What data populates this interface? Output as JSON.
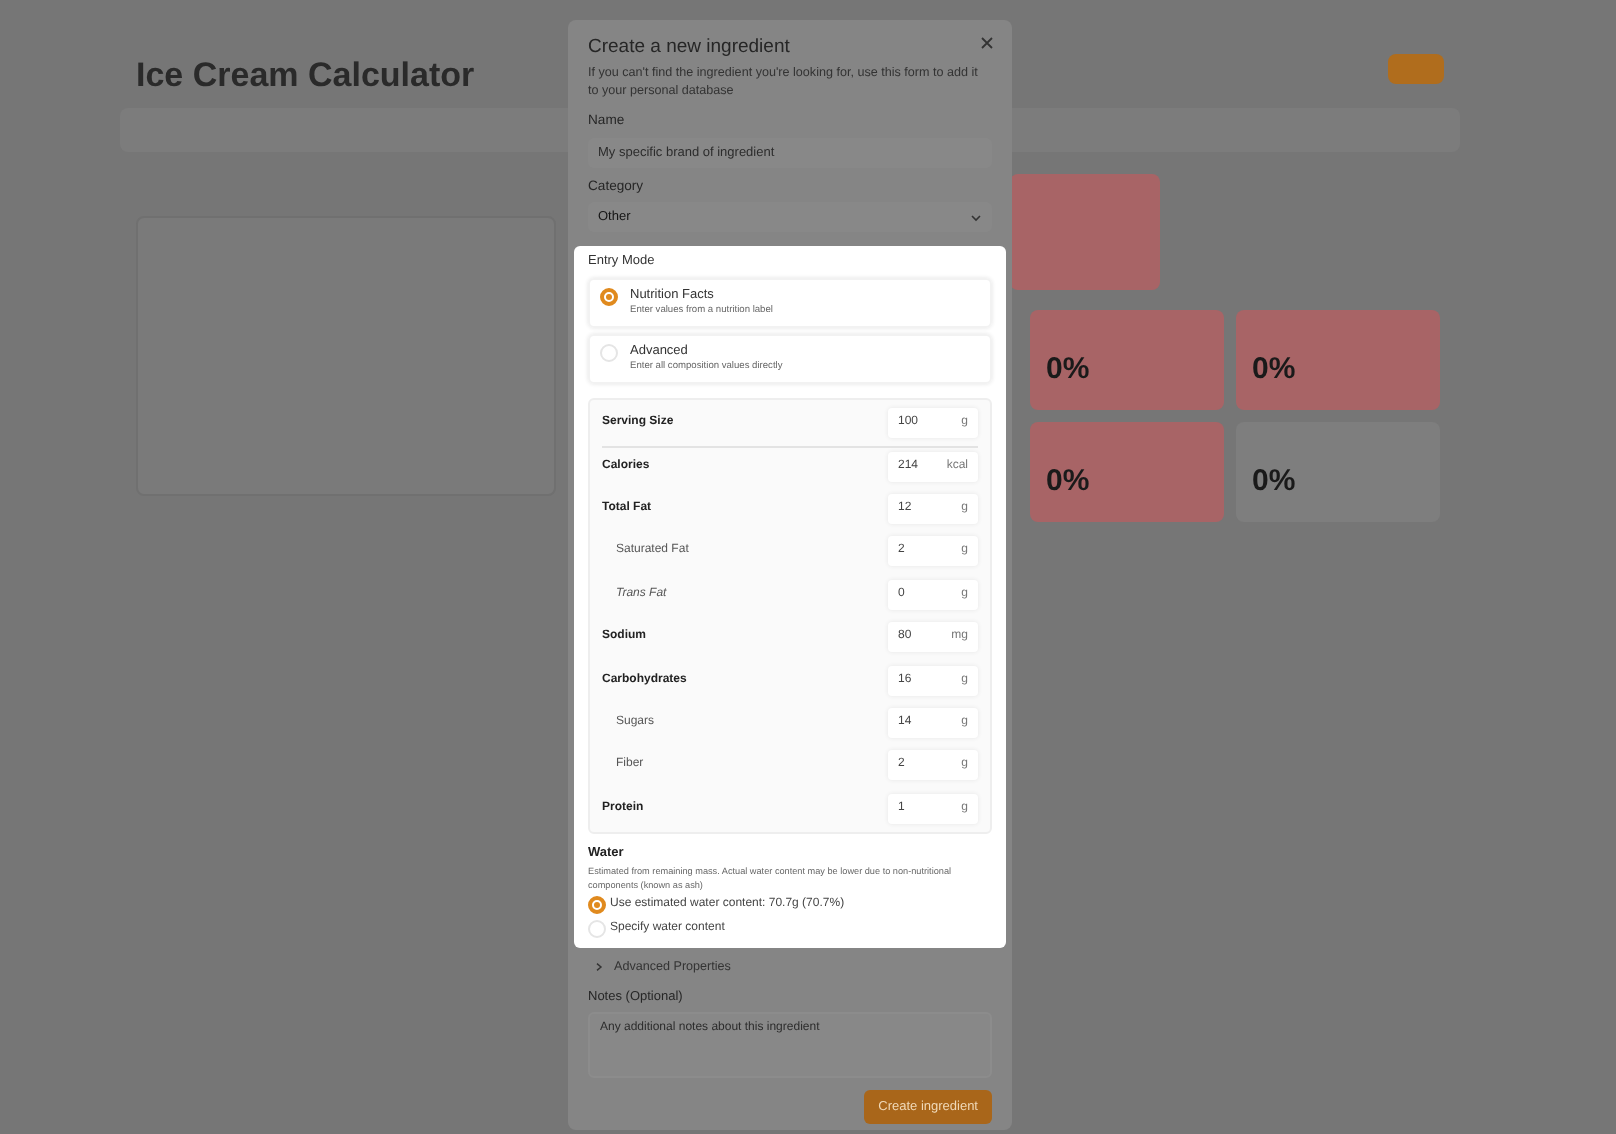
{
  "background": {
    "title": "Ice Cream Calculator",
    "cards": [
      {
        "value": "0%",
        "alert": true
      },
      {
        "value": "0%",
        "alert": true
      },
      {
        "value": "0%",
        "alert": true
      },
      {
        "value": "0%",
        "alert": false
      }
    ]
  },
  "dialog": {
    "title": "Create a new ingredient",
    "description": "If you can't find the ingredient you're looking for, use this form to add it to your personal database",
    "name": {
      "label": "Name",
      "placeholder": "My specific brand of ingredient"
    },
    "category": {
      "label": "Category",
      "value": "Other"
    },
    "entry_mode": {
      "label": "Entry Mode",
      "options": [
        {
          "title": "Nutrition Facts",
          "subtitle": "Enter values from a nutrition label",
          "selected": true
        },
        {
          "title": "Advanced",
          "subtitle": "Enter all composition values directly",
          "selected": false
        }
      ]
    },
    "nutrition": [
      {
        "label": "Serving Size",
        "value": "100",
        "unit": "g",
        "kind": "main"
      },
      {
        "label": "Calories",
        "value": "214",
        "unit": "kcal",
        "kind": "main"
      },
      {
        "label": "Total Fat",
        "value": "12",
        "unit": "g",
        "kind": "main"
      },
      {
        "label": "Saturated Fat",
        "value": "2",
        "unit": "g",
        "kind": "sub"
      },
      {
        "label": "Trans Fat",
        "value": "0",
        "unit": "g",
        "kind": "sub-italic"
      },
      {
        "label": "Sodium",
        "value": "80",
        "unit": "mg",
        "kind": "main"
      },
      {
        "label": "Carbohydrates",
        "value": "16",
        "unit": "g",
        "kind": "main"
      },
      {
        "label": "Sugars",
        "value": "14",
        "unit": "g",
        "kind": "sub"
      },
      {
        "label": "Fiber",
        "value": "2",
        "unit": "g",
        "kind": "sub"
      },
      {
        "label": "Protein",
        "value": "1",
        "unit": "g",
        "kind": "main"
      }
    ],
    "water": {
      "label": "Water",
      "note": "Estimated from remaining mass. Actual water content may be lower due to non-nutritional components (known as ash)",
      "options": [
        {
          "label": "Use estimated water content: 70.7g (70.7%)",
          "selected": true
        },
        {
          "label": "Specify water content",
          "selected": false
        }
      ]
    },
    "advanced_properties": {
      "label": "Advanced Properties",
      "expanded": false
    },
    "notes": {
      "label": "Notes (Optional)",
      "placeholder": "Any additional notes about this ingredient"
    },
    "submit": "Create ingredient"
  }
}
